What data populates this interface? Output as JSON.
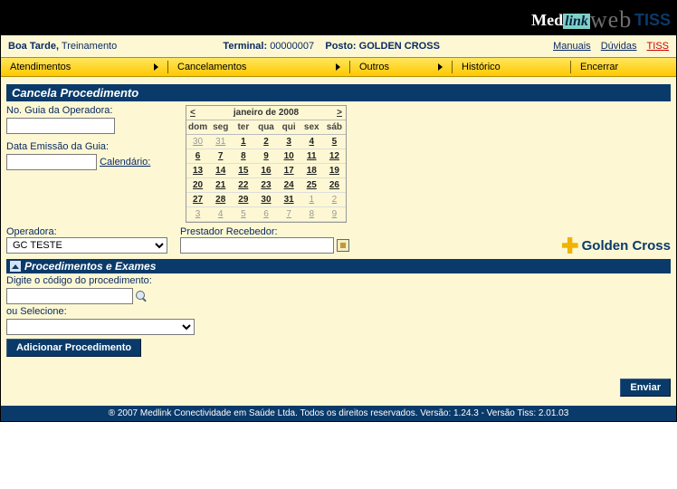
{
  "header": {
    "logo": {
      "med": "Med",
      "link": "link",
      "web": "web",
      "tiss": "TISS"
    }
  },
  "infobar": {
    "greeting_label": "Boa Tarde,",
    "user": "Treinamento",
    "terminal_label": "Terminal:",
    "terminal_value": "00000007",
    "posto_label": "Posto:",
    "posto_value": "GOLDEN CROSS",
    "links": {
      "manuais": "Manuais",
      "duvidas": "Dúvidas",
      "tiss": "TISS"
    }
  },
  "menu": {
    "atendimentos": "Atendimentos",
    "cancelamentos": "Cancelamentos",
    "outros": "Outros",
    "historico": "Histórico",
    "encerrar": "Encerrar"
  },
  "section": {
    "title": "Cancela Procedimento",
    "guia_label": "No. Guia da Operadora:",
    "data_label": "Data Emissão da Guia:",
    "calendario_link": "Calendário:",
    "operadora_label": "Operadora:",
    "operadora_value": "GC TESTE",
    "prestador_label": "Prestador Recebedor:",
    "brand": "Golden Cross"
  },
  "calendar": {
    "prev": "<",
    "next": ">",
    "title": "janeiro de 2008",
    "dow": [
      "dom",
      "seg",
      "ter",
      "qua",
      "qui",
      "sex",
      "sáb"
    ],
    "weeks": [
      [
        {
          "d": "30",
          "o": true
        },
        {
          "d": "31",
          "o": true
        },
        {
          "d": "1"
        },
        {
          "d": "2"
        },
        {
          "d": "3"
        },
        {
          "d": "4"
        },
        {
          "d": "5"
        }
      ],
      [
        {
          "d": "6"
        },
        {
          "d": "7"
        },
        {
          "d": "8"
        },
        {
          "d": "9"
        },
        {
          "d": "10"
        },
        {
          "d": "11"
        },
        {
          "d": "12"
        }
      ],
      [
        {
          "d": "13"
        },
        {
          "d": "14"
        },
        {
          "d": "15"
        },
        {
          "d": "16"
        },
        {
          "d": "17"
        },
        {
          "d": "18"
        },
        {
          "d": "19"
        }
      ],
      [
        {
          "d": "20"
        },
        {
          "d": "21"
        },
        {
          "d": "22"
        },
        {
          "d": "23"
        },
        {
          "d": "24"
        },
        {
          "d": "25"
        },
        {
          "d": "26"
        }
      ],
      [
        {
          "d": "27"
        },
        {
          "d": "28"
        },
        {
          "d": "29"
        },
        {
          "d": "30"
        },
        {
          "d": "31"
        },
        {
          "d": "1",
          "o": true
        },
        {
          "d": "2",
          "o": true
        }
      ],
      [
        {
          "d": "3",
          "o": true
        },
        {
          "d": "4",
          "o": true
        },
        {
          "d": "5",
          "o": true
        },
        {
          "d": "6",
          "o": true
        },
        {
          "d": "7",
          "o": true
        },
        {
          "d": "8",
          "o": true
        },
        {
          "d": "9",
          "o": true
        }
      ]
    ]
  },
  "proc": {
    "title": "Procedimentos e Exames",
    "codigo_label": "Digite o código do procedimento:",
    "ou_label": "ou Selecione:",
    "add_btn": "Adicionar Procedimento"
  },
  "send_btn": "Enviar",
  "footer": "® 2007  Medlink Conectividade em Saúde Ltda.    Todos os direitos reservados.    Versão: 1.24.3 - Versão Tiss: 2.01.03"
}
